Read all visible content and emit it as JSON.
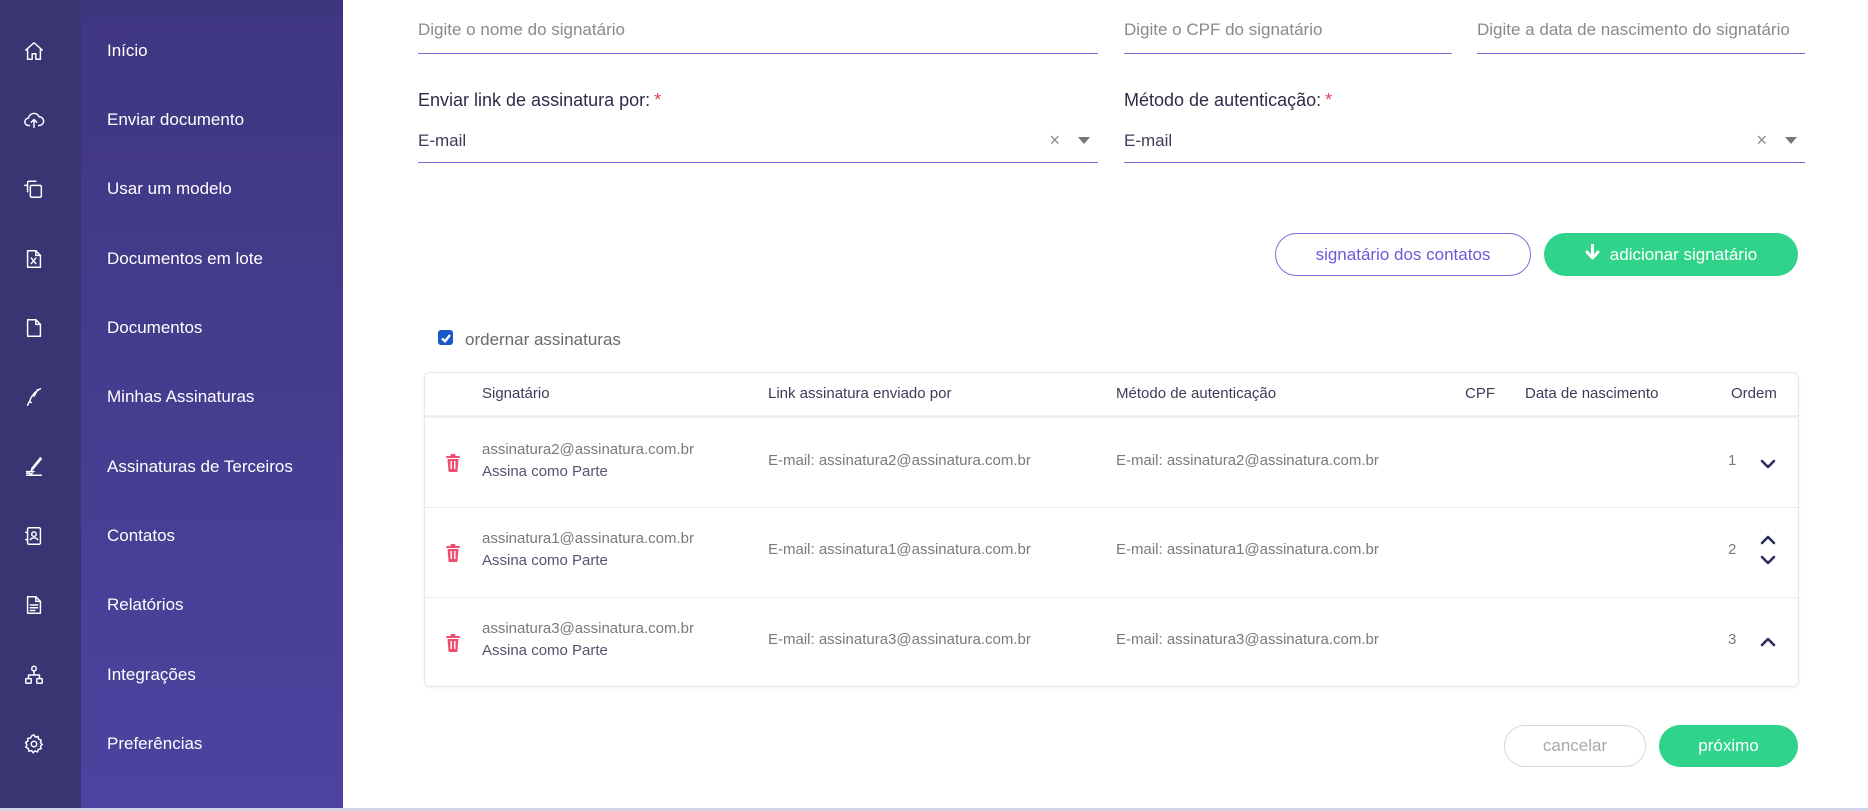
{
  "sidebar": {
    "items": [
      {
        "label": "Início",
        "icon": "home-icon"
      },
      {
        "label": "Enviar documento",
        "icon": "cloud-upload-icon"
      },
      {
        "label": "Usar um modelo",
        "icon": "template-icon"
      },
      {
        "label": "Documentos em lote",
        "icon": "excel-file-icon"
      },
      {
        "label": "Documentos",
        "icon": "document-icon"
      },
      {
        "label": "Minhas Assinaturas",
        "icon": "pen-icon"
      },
      {
        "label": "Assinaturas de Terceiros",
        "icon": "signature-pen-icon"
      },
      {
        "label": "Contatos",
        "icon": "contacts-icon"
      },
      {
        "label": "Relatórios",
        "icon": "report-icon"
      },
      {
        "label": "Integrações",
        "icon": "integration-icon"
      },
      {
        "label": "Preferências",
        "icon": "gear-icon"
      }
    ]
  },
  "form": {
    "name_placeholder": "Digite o nome do signatário",
    "cpf_placeholder": "Digite o CPF do signatário",
    "birth_placeholder": "Digite a data de nascimento do signatário",
    "send_link_label": "Enviar link de assinatura por:",
    "send_link_value": "E-mail",
    "auth_label": "Método de autenticação:",
    "auth_value": "E-mail",
    "required_mark": "*",
    "clear_symbol": "×"
  },
  "actions": {
    "contacts_button": "signatário dos contatos",
    "add_button": "adicionar signatário",
    "cancel_button": "cancelar",
    "next_button": "próximo"
  },
  "order_checkbox": {
    "label": "ordernar assinaturas",
    "checked": true
  },
  "table": {
    "headers": {
      "signer": "Signatário",
      "link": "Link assinatura enviado por",
      "auth": "Método de autenticação",
      "cpf": "CPF",
      "birth": "Data de nascimento",
      "order": "Ordem"
    },
    "rows": [
      {
        "email": "assinatura2@assinatura.com.br",
        "role": "Assina como Parte",
        "link": "E-mail: assinatura2@assinatura.com.br",
        "auth": "E-mail: assinatura2@assinatura.com.br",
        "order": "1"
      },
      {
        "email": "assinatura1@assinatura.com.br",
        "role": "Assina como Parte",
        "link": "E-mail: assinatura1@assinatura.com.br",
        "auth": "E-mail: assinatura1@assinatura.com.br",
        "order": "2"
      },
      {
        "email": "assinatura3@assinatura.com.br",
        "role": "Assina como Parte",
        "link": "E-mail: assinatura3@assinatura.com.br",
        "auth": "E-mail: assinatura3@assinatura.com.br",
        "order": "3"
      }
    ]
  },
  "colors": {
    "sidebar_rail": "#3b3473",
    "sidebar_menu": "#4a41a0",
    "accent_purple": "#7d6cd9",
    "accent_green": "#2fd48a",
    "delete_red": "#ef4d6e"
  }
}
